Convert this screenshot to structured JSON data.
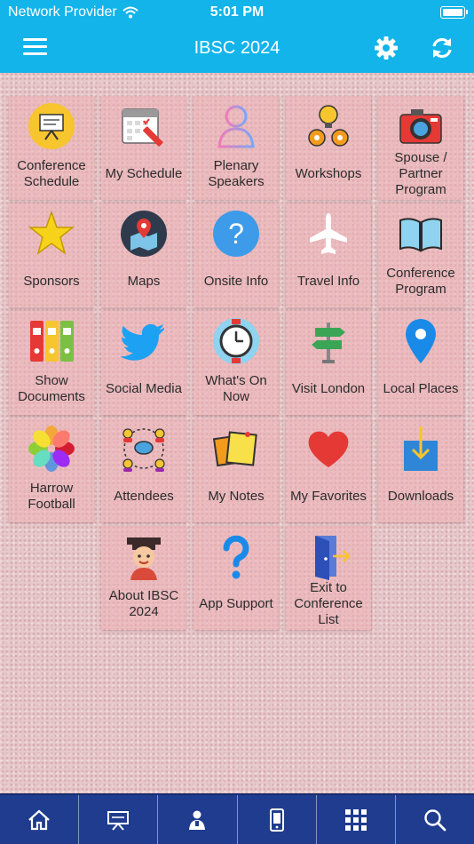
{
  "status_bar": {
    "carrier": "Network Provider",
    "time": "5:01 PM"
  },
  "header": {
    "title": "IBSC 2024",
    "accent_color": "#12b4ea"
  },
  "tiles": [
    {
      "label": "Conference Schedule",
      "icon": "presentation-board-icon"
    },
    {
      "label": "My Schedule",
      "icon": "calendar-pencil-icon"
    },
    {
      "label": "Plenary Speakers",
      "icon": "speaker-person-icon"
    },
    {
      "label": "Workshops",
      "icon": "lightbulb-gears-icon"
    },
    {
      "label": "Spouse / Partner Program",
      "icon": "camera-icon"
    },
    {
      "label": "Sponsors",
      "icon": "star-icon"
    },
    {
      "label": "Maps",
      "icon": "map-pin-icon"
    },
    {
      "label": "Onsite Info",
      "icon": "question-circle-icon"
    },
    {
      "label": "Travel Info",
      "icon": "airplane-icon"
    },
    {
      "label": "Conference Program",
      "icon": "open-book-icon"
    },
    {
      "label": "Show Documents",
      "icon": "binders-icon"
    },
    {
      "label": "Social Media",
      "icon": "twitter-bird-icon"
    },
    {
      "label": "What's On Now",
      "icon": "stopwatch-icon"
    },
    {
      "label": "Visit London",
      "icon": "signpost-icon"
    },
    {
      "label": "Local Places",
      "icon": "location-pin-icon"
    },
    {
      "label": "Harrow Football",
      "icon": "photos-flower-icon"
    },
    {
      "label": "Attendees",
      "icon": "network-people-icon"
    },
    {
      "label": "My Notes",
      "icon": "sticky-notes-icon"
    },
    {
      "label": "My Favorites",
      "icon": "heart-icon"
    },
    {
      "label": "Downloads",
      "icon": "download-box-icon"
    },
    {
      "label": "About IBSC 2024",
      "icon": "graduate-icon"
    },
    {
      "label": "App Support",
      "icon": "question-mark-icon"
    },
    {
      "label": "Exit to Conference List",
      "icon": "exit-door-icon"
    }
  ],
  "bottom_tabs": [
    {
      "icon": "home-icon"
    },
    {
      "icon": "presentation-icon"
    },
    {
      "icon": "speaker-icon"
    },
    {
      "icon": "mobile-phone-icon"
    },
    {
      "icon": "qr-grid-icon"
    },
    {
      "icon": "search-icon"
    }
  ]
}
